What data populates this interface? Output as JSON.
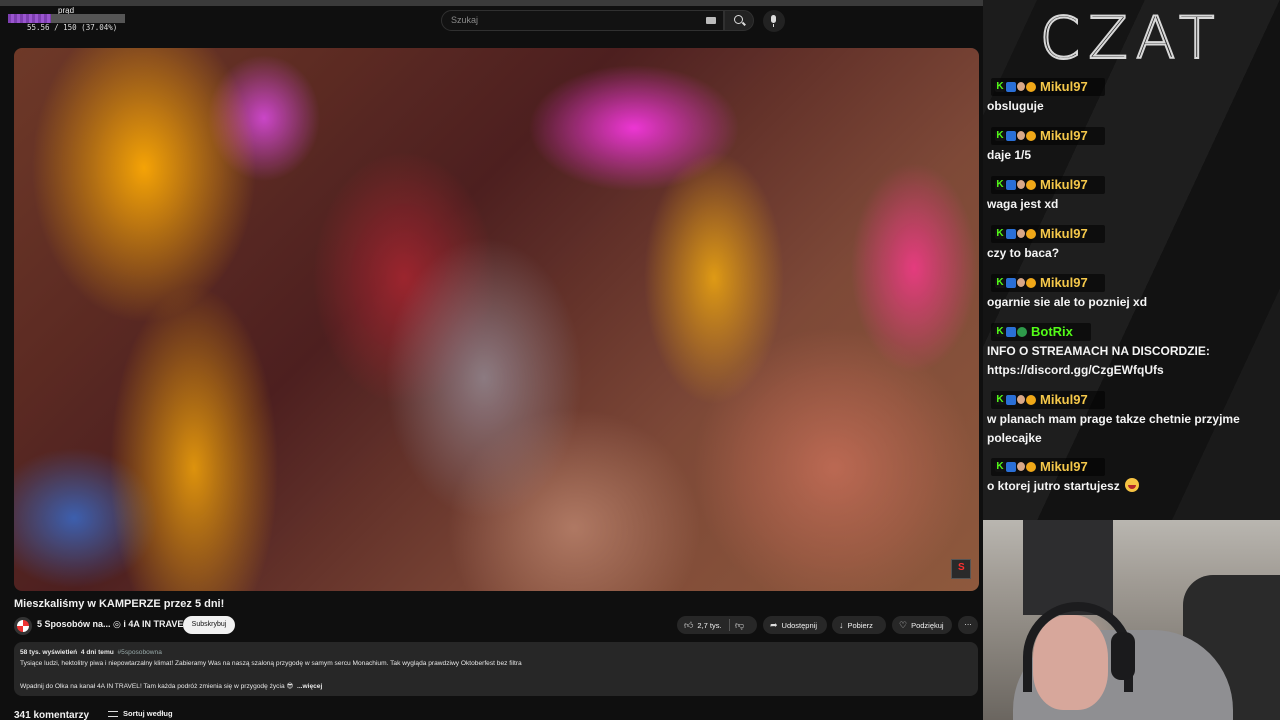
{
  "overlay": {
    "label": "prąd",
    "progress_fraction": 0.3704,
    "text": "55.56 / 150 (37.04%)"
  },
  "search": {
    "placeholder": "Szukaj"
  },
  "video": {
    "title": "Mieszkaliśmy w KAMPERZE przez 5 dni!",
    "channel": "5 Sposobów na... ◎ i 4A IN TRAVEL",
    "subscribe_label": "Subskrybuj",
    "likes": "2,7 tys.",
    "share_label": "Udostępnij",
    "download_label": "Pobierz",
    "thanks_label": "Podziękuj",
    "more_label": "⋯"
  },
  "description": {
    "views": "58 tys. wyświetleń",
    "age": "4 dni temu",
    "hashtag": "#5sposobowna",
    "line1": "Tysiące ludzi, hektolitry piwa i niepowtarzalny klimat! Zabieramy Was na naszą szaloną przygodę w samym sercu Monachium. Tak wygląda prawdziwy Oktoberfest bez filtra",
    "line2": "Wpadnij do Olka na kanał 4A IN TRAVEL! Tam każda podróż zmienia się w przygodę życia 😎",
    "more_link": "...więcej"
  },
  "comments": {
    "count": "341 komentarzy",
    "sort_label": "Sortuj według"
  },
  "chat": {
    "title": "CZAT",
    "colors": {
      "mikul": "#f5c84a",
      "botrix": "#53fc18"
    },
    "messages": [
      {
        "user": "Mikul97",
        "text": "obsluguje"
      },
      {
        "user": "Mikul97",
        "text": "daje 1/5"
      },
      {
        "user": "Mikul97",
        "text": "waga jest xd"
      },
      {
        "user": "Mikul97",
        "text": "czy to baca?"
      },
      {
        "user": "Mikul97",
        "text": "ogarnie sie ale to pozniej xd"
      },
      {
        "user": "BotRix",
        "text": "INFO O STREAMACH NA DISCORDZIE:",
        "text2": "https://discord.gg/CzgEWfqUfs"
      },
      {
        "user": "Mikul97",
        "text": "w planach mam prage takze chetnie przyjme",
        "text2": "polecajke"
      },
      {
        "user": "Mikul97",
        "text": "o ktorej jutro startujesz"
      }
    ]
  }
}
